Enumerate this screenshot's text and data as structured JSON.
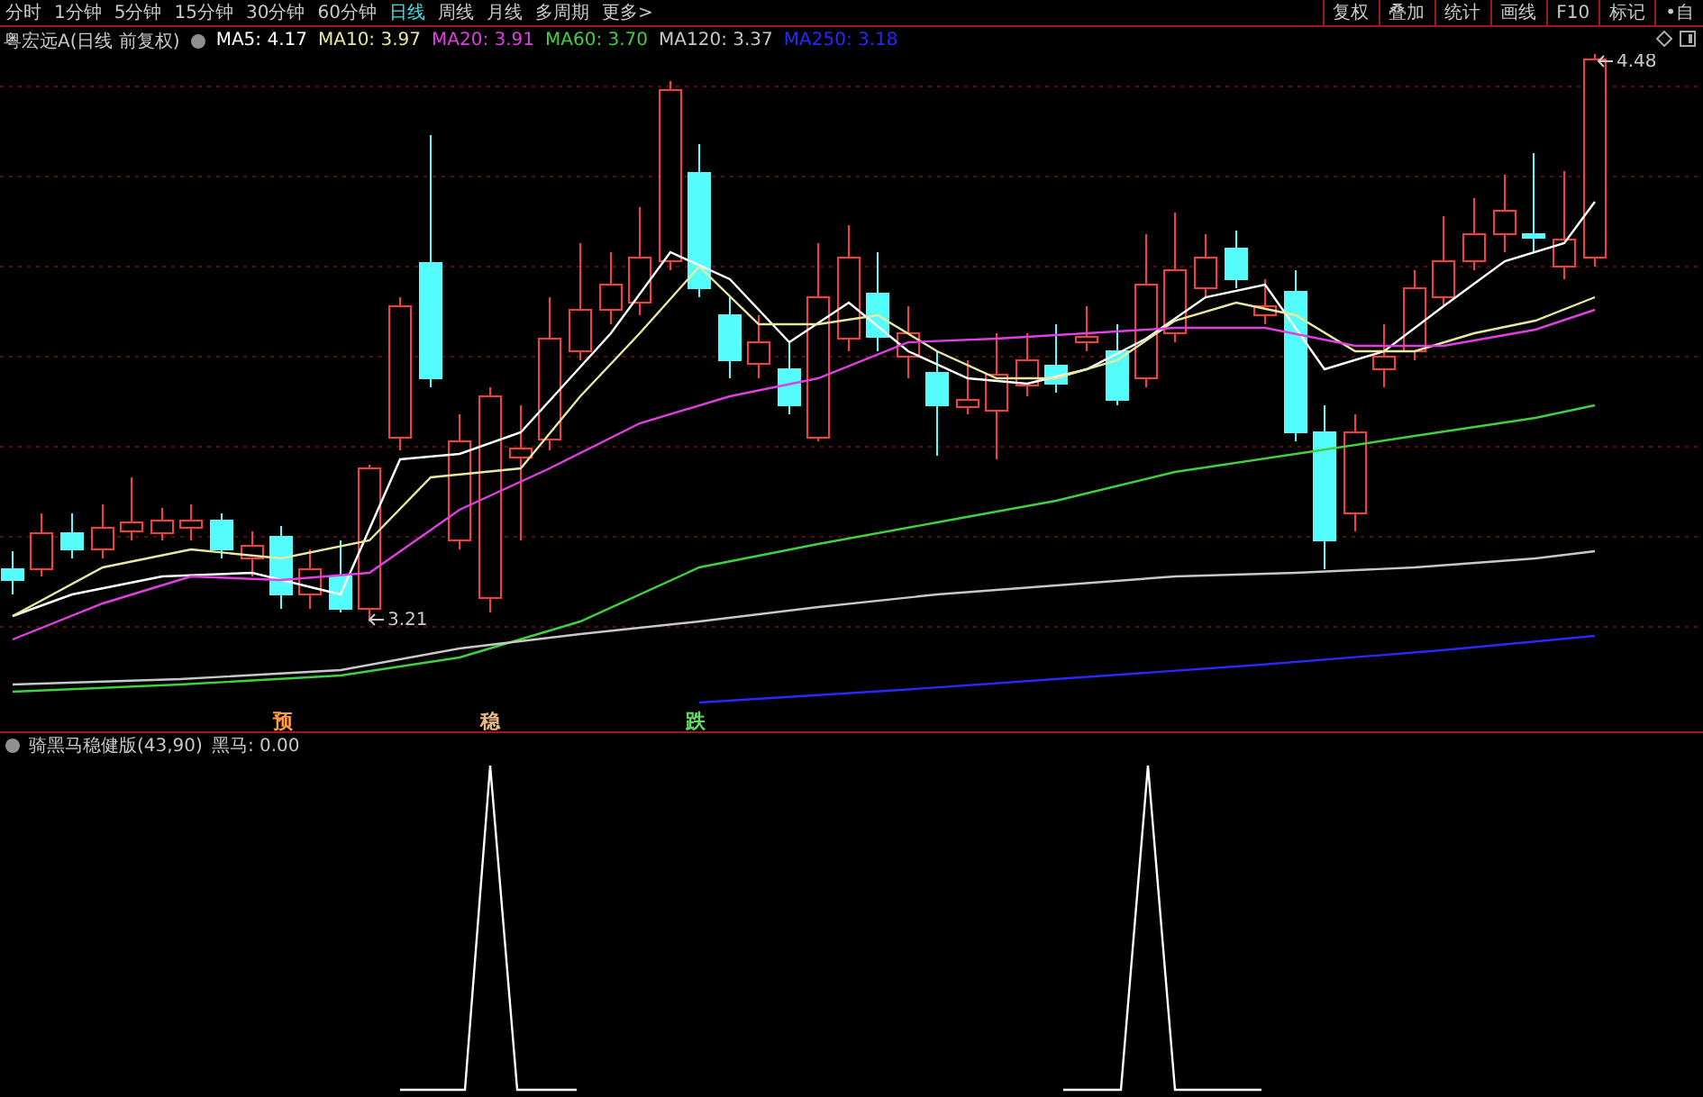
{
  "tabs": [
    {
      "label": "分时",
      "selected": false
    },
    {
      "label": "1分钟",
      "selected": false
    },
    {
      "label": "5分钟",
      "selected": false
    },
    {
      "label": "15分钟",
      "selected": false
    },
    {
      "label": "30分钟",
      "selected": false
    },
    {
      "label": "60分钟",
      "selected": false
    },
    {
      "label": "日线",
      "selected": true
    },
    {
      "label": "周线",
      "selected": false
    },
    {
      "label": "月线",
      "selected": false
    },
    {
      "label": "多周期",
      "selected": false
    },
    {
      "label": "更多>",
      "selected": false
    }
  ],
  "toolbar_buttons": [
    "复权",
    "叠加",
    "统计",
    "画线",
    "F10",
    "标记",
    "•自"
  ],
  "legend": {
    "title": "粤宏远A(日线 前复权)",
    "averages": [
      {
        "label": "MA5: 4.17",
        "color": "#ffffff"
      },
      {
        "label": "MA10: 3.97",
        "color": "#e8e8a0"
      },
      {
        "label": "MA20: 3.91",
        "color": "#e040e0"
      },
      {
        "label": "MA60: 3.70",
        "color": "#40d040"
      },
      {
        "label": "MA120: 3.37",
        "color": "#c8c8c8"
      },
      {
        "label": "MA250: 3.18",
        "color": "#2828ff"
      }
    ]
  },
  "chart": {
    "price_labels": [
      "3.21",
      "4.48"
    ],
    "signals": [
      {
        "text": "预",
        "color": "#ff9a40"
      },
      {
        "text": "稳",
        "color": "#e8b888"
      },
      {
        "text": "跌",
        "color": "#60e060"
      }
    ]
  },
  "indicator": {
    "title": "骑黑马稳健版(43,90)",
    "reading": "黑马: 0.00"
  }
}
